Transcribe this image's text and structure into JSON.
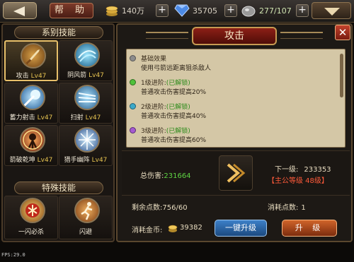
{
  "topbar": {
    "help_label": "帮 助",
    "coins": "140万",
    "gems": "35705",
    "stamina": "277/107"
  },
  "left": {
    "section1_title": "系别技能",
    "skills": [
      {
        "name": "攻击",
        "level": "Lv47",
        "icon": "sword-skill-icon"
      },
      {
        "name": "阴风箭",
        "level": "Lv47",
        "icon": "wind-arrow-skill-icon"
      },
      {
        "name": "蓄力射击",
        "level": "Lv47",
        "icon": "charged-shot-skill-icon"
      },
      {
        "name": "扫射",
        "level": "Lv47",
        "icon": "strafe-skill-icon"
      },
      {
        "name": "箭破乾坤",
        "level": "Lv47",
        "icon": "arrow-burst-skill-icon"
      },
      {
        "name": "猎手幽阵",
        "level": "Lv47",
        "icon": "hunter-array-skill-icon"
      }
    ],
    "section2_title": "特殊技能",
    "special": [
      {
        "name": "一闪必杀",
        "icon": "instant-kill-skill-icon"
      },
      {
        "name": "闪避",
        "icon": "dodge-skill-icon"
      }
    ]
  },
  "detail": {
    "title": "攻击",
    "close": "✕",
    "base_title": "基础效果",
    "base_desc": "使用弓箭远距离狙杀敌人",
    "stages": [
      {
        "title": "1级进阶:",
        "status": "(已解锁)",
        "desc": "普通攻击伤害提高20%",
        "color": "#4fc13a"
      },
      {
        "title": "2级进阶:",
        "status": "(已解锁)",
        "desc": "普通攻击伤害提高40%",
        "color": "#3ba9c9"
      },
      {
        "title": "3级进阶:",
        "status": "(已解锁)",
        "desc": "普通攻击伤害提高60%",
        "color": "#a55bd0"
      }
    ],
    "total_damage_label": "总伤害:",
    "total_damage_value": "231664",
    "next_level_label": "下一级:",
    "next_level_value": "233353",
    "requirement": "【主公等级 48级】",
    "remaining_points_label": "剩余点数:",
    "remaining_points_value": "756/60",
    "cost_points_label": "消耗点数:",
    "cost_points_value": "1",
    "cost_gold_label": "消耗金币:",
    "cost_gold_value": "39382",
    "onekey_label": "一键升级",
    "upgrade_label": "升 级"
  },
  "fps": "FPS:29.0"
}
